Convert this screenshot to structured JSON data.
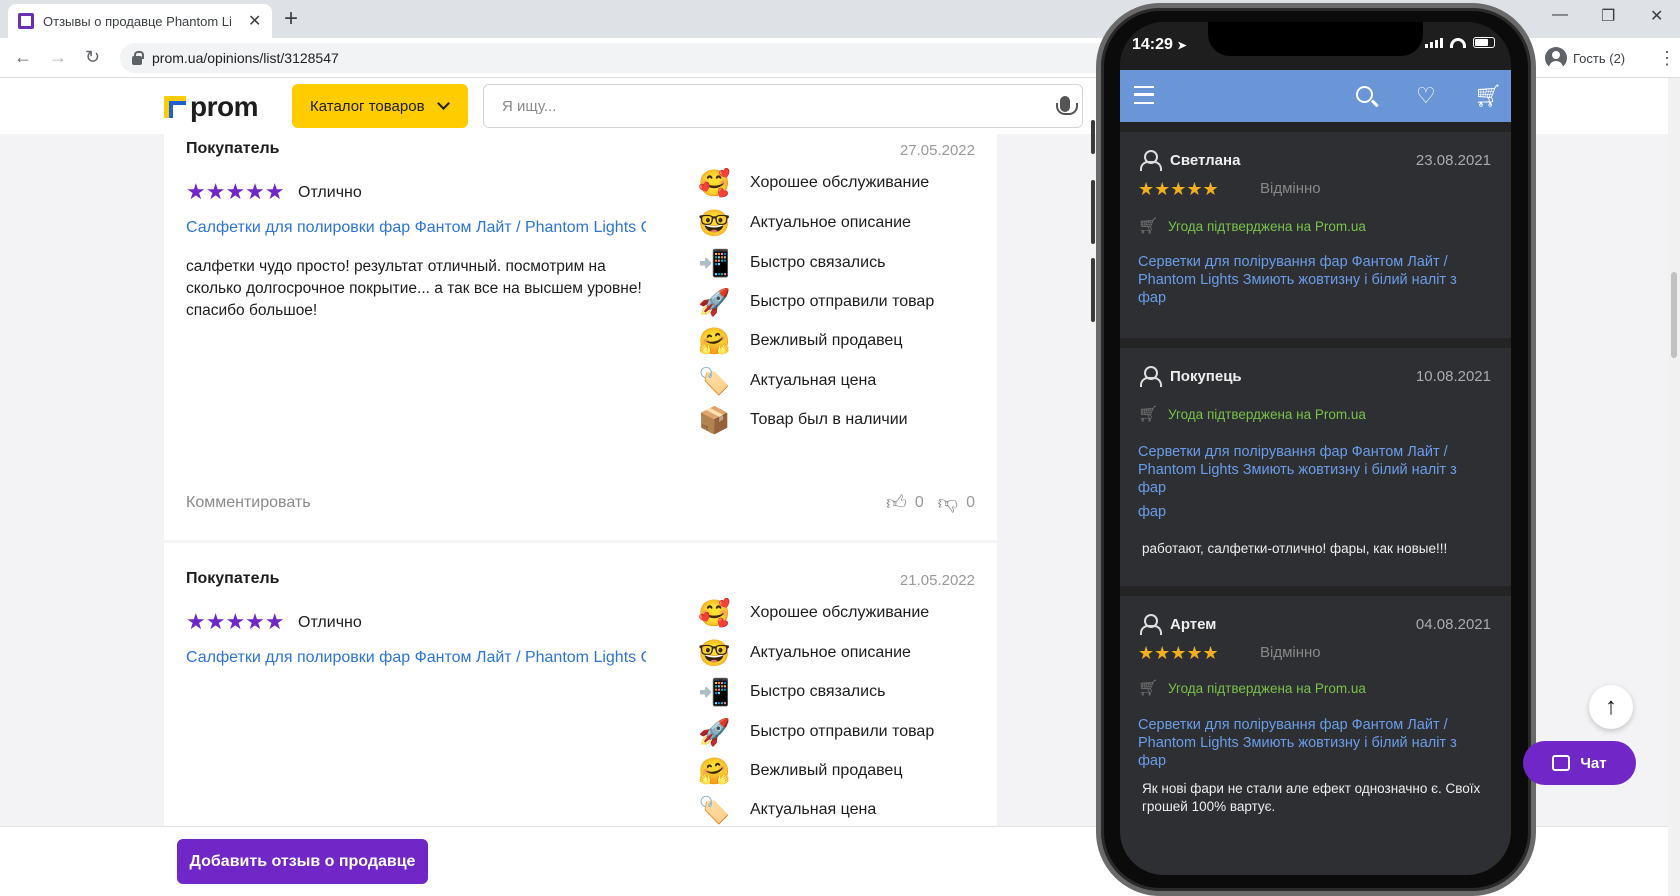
{
  "browser": {
    "tab_title": "Отзывы о продавце Phantom Li",
    "tab_close": "✕",
    "new_tab": "+",
    "url": "prom.ua/opinions/list/3128547",
    "profile": "Гость (2)",
    "controls": {
      "minimize": "—",
      "maximize": "❐",
      "close": "✕"
    },
    "nav": {
      "back": "←",
      "forward": "→",
      "reload": "↻",
      "menu": "⋮"
    }
  },
  "header": {
    "logo": "prom",
    "catalog_label": "Каталог товаров",
    "search_placeholder": "Я ищу..."
  },
  "reviews": [
    {
      "author": "Покупатель",
      "date": "27.05.2022",
      "stars": "★★★★★",
      "rating_word": "Отлично",
      "product": "Салфетки для полировки фар Фантом Лайт / Phantom Lights См...",
      "text": "салфетки чудо просто! результат отличный. посмотрим на сколько долгосрочное покрытие... а так все на высшем уровне! спасибо большое!",
      "tags": [
        {
          "emoji": "🥰",
          "label": "Хорошее обслуживание"
        },
        {
          "emoji": "🤓",
          "label": "Актуальное описание"
        },
        {
          "emoji": "📲",
          "label": "Быстро связались"
        },
        {
          "emoji": "🚀",
          "label": "Быстро отправили товар"
        },
        {
          "emoji": "🤗",
          "label": "Вежливый продавец"
        },
        {
          "emoji": "🏷️",
          "label": "Актуальная цена"
        },
        {
          "emoji": "📦",
          "label": "Товар был в наличии"
        }
      ],
      "comment_label": "Комментировать",
      "likes": "0",
      "dislikes": "0"
    },
    {
      "author": "Покупатель",
      "date": "21.05.2022",
      "stars": "★★★★★",
      "rating_word": "Отлично",
      "product": "Салфетки для полировки фар Фантом Лайт / Phantom Lights См...",
      "tags": [
        {
          "emoji": "🥰",
          "label": "Хорошее обслуживание"
        },
        {
          "emoji": "🤓",
          "label": "Актуальное описание"
        },
        {
          "emoji": "📲",
          "label": "Быстро связались"
        },
        {
          "emoji": "🚀",
          "label": "Быстро отправили товар"
        },
        {
          "emoji": "🤗",
          "label": "Вежливый продавец"
        },
        {
          "emoji": "🏷️",
          "label": "Актуальная цена"
        }
      ]
    }
  ],
  "footer": {
    "add_review": "Добавить отзыв о продавце",
    "chat": "Чат",
    "scroll_top": "↑"
  },
  "phone": {
    "time": "14:29",
    "location_glyph": "➤",
    "cards": [
      {
        "name": "Светлана",
        "date": "23.08.2021",
        "stars": "★★★★★",
        "rating_word": "Відмінно",
        "verified": "Угода підтверджена на Prom.ua",
        "product": "Серветки для полірування фар Фантом Лайт / Phantom Lights Змиють жовтизну і білий наліт з фар"
      },
      {
        "name": "Покупець",
        "date": "10.08.2021",
        "verified": "Угода підтверджена на Prom.ua",
        "product": "Серветки для полірування фар Фантом Лайт / Phantom Lights Змиють жовтизну і білий наліт з фар",
        "product_tail": "фар",
        "text": "работают, салфетки-отлично!  фары, как новые!!!"
      },
      {
        "name": "Артем",
        "date": "04.08.2021",
        "stars": "★★★★★",
        "rating_word": "Відмінно",
        "verified": "Угода підтверджена на Prom.ua",
        "product": "Серветки для полірування фар Фантом Лайт / Phantom Lights Змиють жовтизну і білий наліт з фар",
        "text": "Як нові фари не стали але ефект однозначно є. Своїх грошей 100% вартує."
      }
    ]
  }
}
